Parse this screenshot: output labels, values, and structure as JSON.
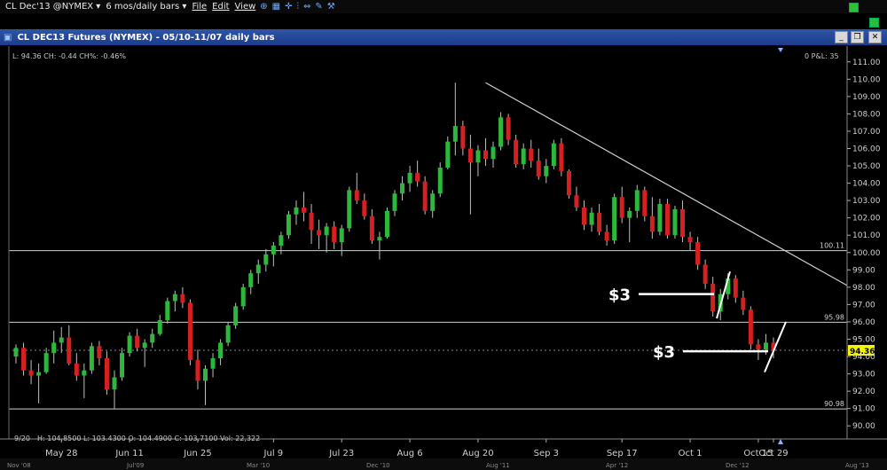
{
  "menubar": {
    "symbol": "CL Dec'13 @NYMEX",
    "period": "6 mos/daily bars",
    "menu_file": "File",
    "menu_edit": "Edit",
    "menu_view": "View"
  },
  "window": {
    "title": "CL DEC13 Futures (NYMEX) - 05/10-11/07 daily bars"
  },
  "readouts": {
    "last": "L: 94.36  CH: -0.44  CH%: -0.46%",
    "position": "0 P&L: 35",
    "bar_info": "H: 104.8500  L: 103.4300  O: 104.4900  C: 103.7100  Vol: 22,322",
    "bar_date": "9/20"
  },
  "chart_data": {
    "type": "candlestick",
    "ylim": [
      89.5,
      111.5
    ],
    "yticks": [
      "90.00",
      "91.00",
      "92.00",
      "93.00",
      "94.00",
      "95.00",
      "96.00",
      "97.00",
      "98.00",
      "99.00",
      "100.00",
      "101.00",
      "102.00",
      "103.00",
      "104.00",
      "105.00",
      "106.00",
      "107.00",
      "108.00",
      "109.00",
      "110.00",
      "111.00"
    ],
    "xticks": [
      "May 28",
      "Jun 11",
      "Jun 25",
      "Jul 9",
      "Jul 23",
      "Aug 6",
      "Aug 20",
      "Sep 3",
      "Sep 17",
      "Oct 1",
      "Oct 15",
      "Oct 29"
    ],
    "overview_labels": [
      "Nov '08",
      "Jul'09",
      "Mar '10",
      "Dec '10",
      "Aug '11",
      "Apr '12",
      "Dec '12",
      "Aug '13"
    ],
    "hlines": [
      {
        "value": 100.11,
        "label": "100.11"
      },
      {
        "value": 95.98,
        "label": "95.98"
      },
      {
        "value": 90.98,
        "label": "90.98"
      }
    ],
    "last_price": {
      "value": 94.36,
      "label": "94.36",
      "color": "#f5f500"
    },
    "trendline": {
      "from": [
        0,
        109.8
      ],
      "to": [
        1,
        98.1
      ]
    },
    "annotations": [
      {
        "text": "$3",
        "price": 97.6
      },
      {
        "text": "$3",
        "price": 94.3
      }
    ],
    "colors": {
      "up": "#2db83d",
      "down": "#d42020",
      "line": "#cfcfcf"
    },
    "series": [
      {
        "name": "candles",
        "values": [
          [
            94.0,
            94.7,
            93.6,
            94.5
          ],
          [
            94.5,
            94.8,
            92.9,
            93.2
          ],
          [
            93.2,
            93.8,
            92.4,
            92.9
          ],
          [
            92.9,
            93.6,
            91.3,
            93.1
          ],
          [
            93.1,
            94.5,
            93.0,
            94.2
          ],
          [
            94.2,
            95.5,
            93.6,
            94.8
          ],
          [
            94.8,
            95.7,
            94.2,
            95.1
          ],
          [
            95.1,
            95.8,
            93.5,
            93.6
          ],
          [
            93.6,
            94.2,
            92.6,
            92.9
          ],
          [
            92.9,
            93.6,
            91.6,
            93.2
          ],
          [
            93.2,
            94.8,
            93.0,
            94.6
          ],
          [
            94.6,
            94.9,
            93.5,
            93.9
          ],
          [
            93.9,
            94.3,
            91.8,
            92.1
          ],
          [
            92.1,
            93.2,
            91.0,
            92.8
          ],
          [
            92.8,
            94.5,
            92.6,
            94.2
          ],
          [
            94.2,
            95.4,
            94.0,
            95.2
          ],
          [
            95.2,
            95.6,
            94.3,
            94.5
          ],
          [
            94.5,
            95.0,
            93.4,
            94.8
          ],
          [
            94.8,
            95.6,
            94.5,
            95.3
          ],
          [
            95.3,
            96.4,
            95.2,
            96.1
          ],
          [
            96.1,
            97.4,
            95.9,
            97.2
          ],
          [
            97.2,
            97.8,
            96.6,
            97.6
          ],
          [
            97.6,
            98.0,
            96.8,
            97.1
          ],
          [
            97.1,
            97.3,
            93.5,
            93.8
          ],
          [
            93.8,
            94.4,
            92.1,
            92.6
          ],
          [
            92.6,
            93.5,
            91.2,
            93.3
          ],
          [
            93.3,
            94.2,
            92.8,
            93.9
          ],
          [
            93.9,
            95.0,
            93.5,
            94.8
          ],
          [
            94.8,
            96.0,
            94.6,
            95.8
          ],
          [
            95.8,
            97.1,
            95.6,
            96.9
          ],
          [
            96.9,
            98.2,
            96.7,
            98.0
          ],
          [
            98.0,
            99.0,
            97.6,
            98.8
          ],
          [
            98.8,
            99.6,
            98.2,
            99.3
          ],
          [
            99.3,
            100.2,
            98.9,
            99.9
          ],
          [
            99.9,
            100.6,
            99.2,
            100.4
          ],
          [
            100.4,
            101.2,
            99.9,
            101.0
          ],
          [
            101.0,
            102.4,
            100.8,
            102.2
          ],
          [
            102.2,
            103.0,
            101.6,
            102.6
          ],
          [
            102.6,
            103.5,
            101.8,
            102.3
          ],
          [
            102.3,
            102.8,
            100.5,
            101.3
          ],
          [
            101.3,
            101.9,
            100.2,
            101.0
          ],
          [
            101.0,
            101.7,
            100.0,
            101.5
          ],
          [
            101.5,
            101.8,
            100.2,
            100.6
          ],
          [
            100.6,
            101.6,
            99.8,
            101.4
          ],
          [
            101.4,
            103.8,
            101.2,
            103.6
          ],
          [
            103.6,
            104.6,
            102.8,
            103.0
          ],
          [
            103.0,
            103.4,
            101.9,
            102.1
          ],
          [
            102.1,
            102.5,
            100.5,
            100.7
          ],
          [
            100.7,
            101.2,
            99.6,
            100.9
          ],
          [
            100.9,
            102.6,
            100.8,
            102.4
          ],
          [
            102.4,
            103.6,
            102.1,
            103.4
          ],
          [
            103.4,
            104.4,
            103.0,
            104.0
          ],
          [
            104.0,
            105.0,
            103.5,
            104.6
          ],
          [
            104.6,
            105.3,
            103.8,
            104.1
          ],
          [
            104.1,
            104.4,
            102.2,
            102.4
          ],
          [
            102.4,
            103.6,
            102.0,
            103.4
          ],
          [
            103.4,
            105.2,
            103.2,
            104.9
          ],
          [
            104.9,
            106.7,
            104.8,
            106.4
          ],
          [
            106.4,
            109.8,
            105.6,
            107.3
          ],
          [
            107.3,
            107.6,
            105.6,
            106.0
          ],
          [
            106.0,
            106.8,
            102.2,
            105.2
          ],
          [
            105.2,
            106.2,
            104.4,
            105.9
          ],
          [
            105.9,
            106.6,
            105.0,
            105.4
          ],
          [
            105.4,
            106.4,
            104.9,
            106.1
          ],
          [
            106.1,
            108.1,
            105.9,
            107.8
          ],
          [
            107.8,
            108.0,
            106.2,
            106.5
          ],
          [
            106.5,
            106.8,
            104.9,
            105.1
          ],
          [
            105.1,
            106.3,
            104.8,
            106.0
          ],
          [
            106.0,
            106.5,
            104.9,
            105.3
          ],
          [
            105.3,
            106.0,
            104.2,
            104.4
          ],
          [
            104.4,
            105.4,
            104.0,
            105.0
          ],
          [
            105.0,
            106.5,
            104.8,
            106.3
          ],
          [
            106.3,
            106.6,
            104.4,
            104.7
          ],
          [
            104.7,
            104.8,
            103.1,
            103.3
          ],
          [
            103.3,
            103.8,
            102.4,
            102.6
          ],
          [
            102.6,
            103.0,
            101.3,
            101.6
          ],
          [
            101.6,
            102.6,
            101.2,
            102.3
          ],
          [
            102.3,
            102.8,
            101.0,
            101.2
          ],
          [
            101.2,
            101.6,
            100.4,
            100.7
          ],
          [
            100.7,
            103.4,
            100.5,
            103.2
          ],
          [
            103.2,
            103.8,
            101.7,
            102.0
          ],
          [
            102.0,
            102.6,
            100.6,
            102.4
          ],
          [
            102.4,
            103.9,
            102.0,
            103.6
          ],
          [
            103.6,
            103.8,
            101.8,
            102.1
          ],
          [
            102.1,
            103.2,
            100.8,
            101.2
          ],
          [
            101.2,
            103.1,
            101.0,
            102.8
          ],
          [
            102.8,
            103.1,
            100.8,
            101.0
          ],
          [
            101.0,
            102.7,
            100.8,
            102.5
          ],
          [
            102.5,
            103.0,
            100.6,
            100.9
          ],
          [
            100.9,
            101.2,
            100.1,
            100.6
          ],
          [
            100.6,
            100.9,
            99.0,
            99.3
          ],
          [
            99.3,
            99.6,
            97.9,
            98.2
          ],
          [
            98.2,
            98.6,
            96.3,
            96.6
          ],
          [
            96.6,
            97.9,
            96.1,
            97.6
          ],
          [
            97.6,
            98.8,
            97.3,
            98.5
          ],
          [
            98.5,
            98.7,
            97.1,
            97.4
          ],
          [
            97.4,
            97.8,
            96.4,
            96.7
          ],
          [
            96.7,
            96.9,
            94.4,
            94.7
          ],
          [
            94.7,
            95.0,
            93.8,
            94.4
          ],
          [
            94.4,
            95.3,
            94.1,
            94.8
          ],
          [
            94.8,
            95.1,
            93.9,
            94.36
          ]
        ]
      }
    ]
  }
}
